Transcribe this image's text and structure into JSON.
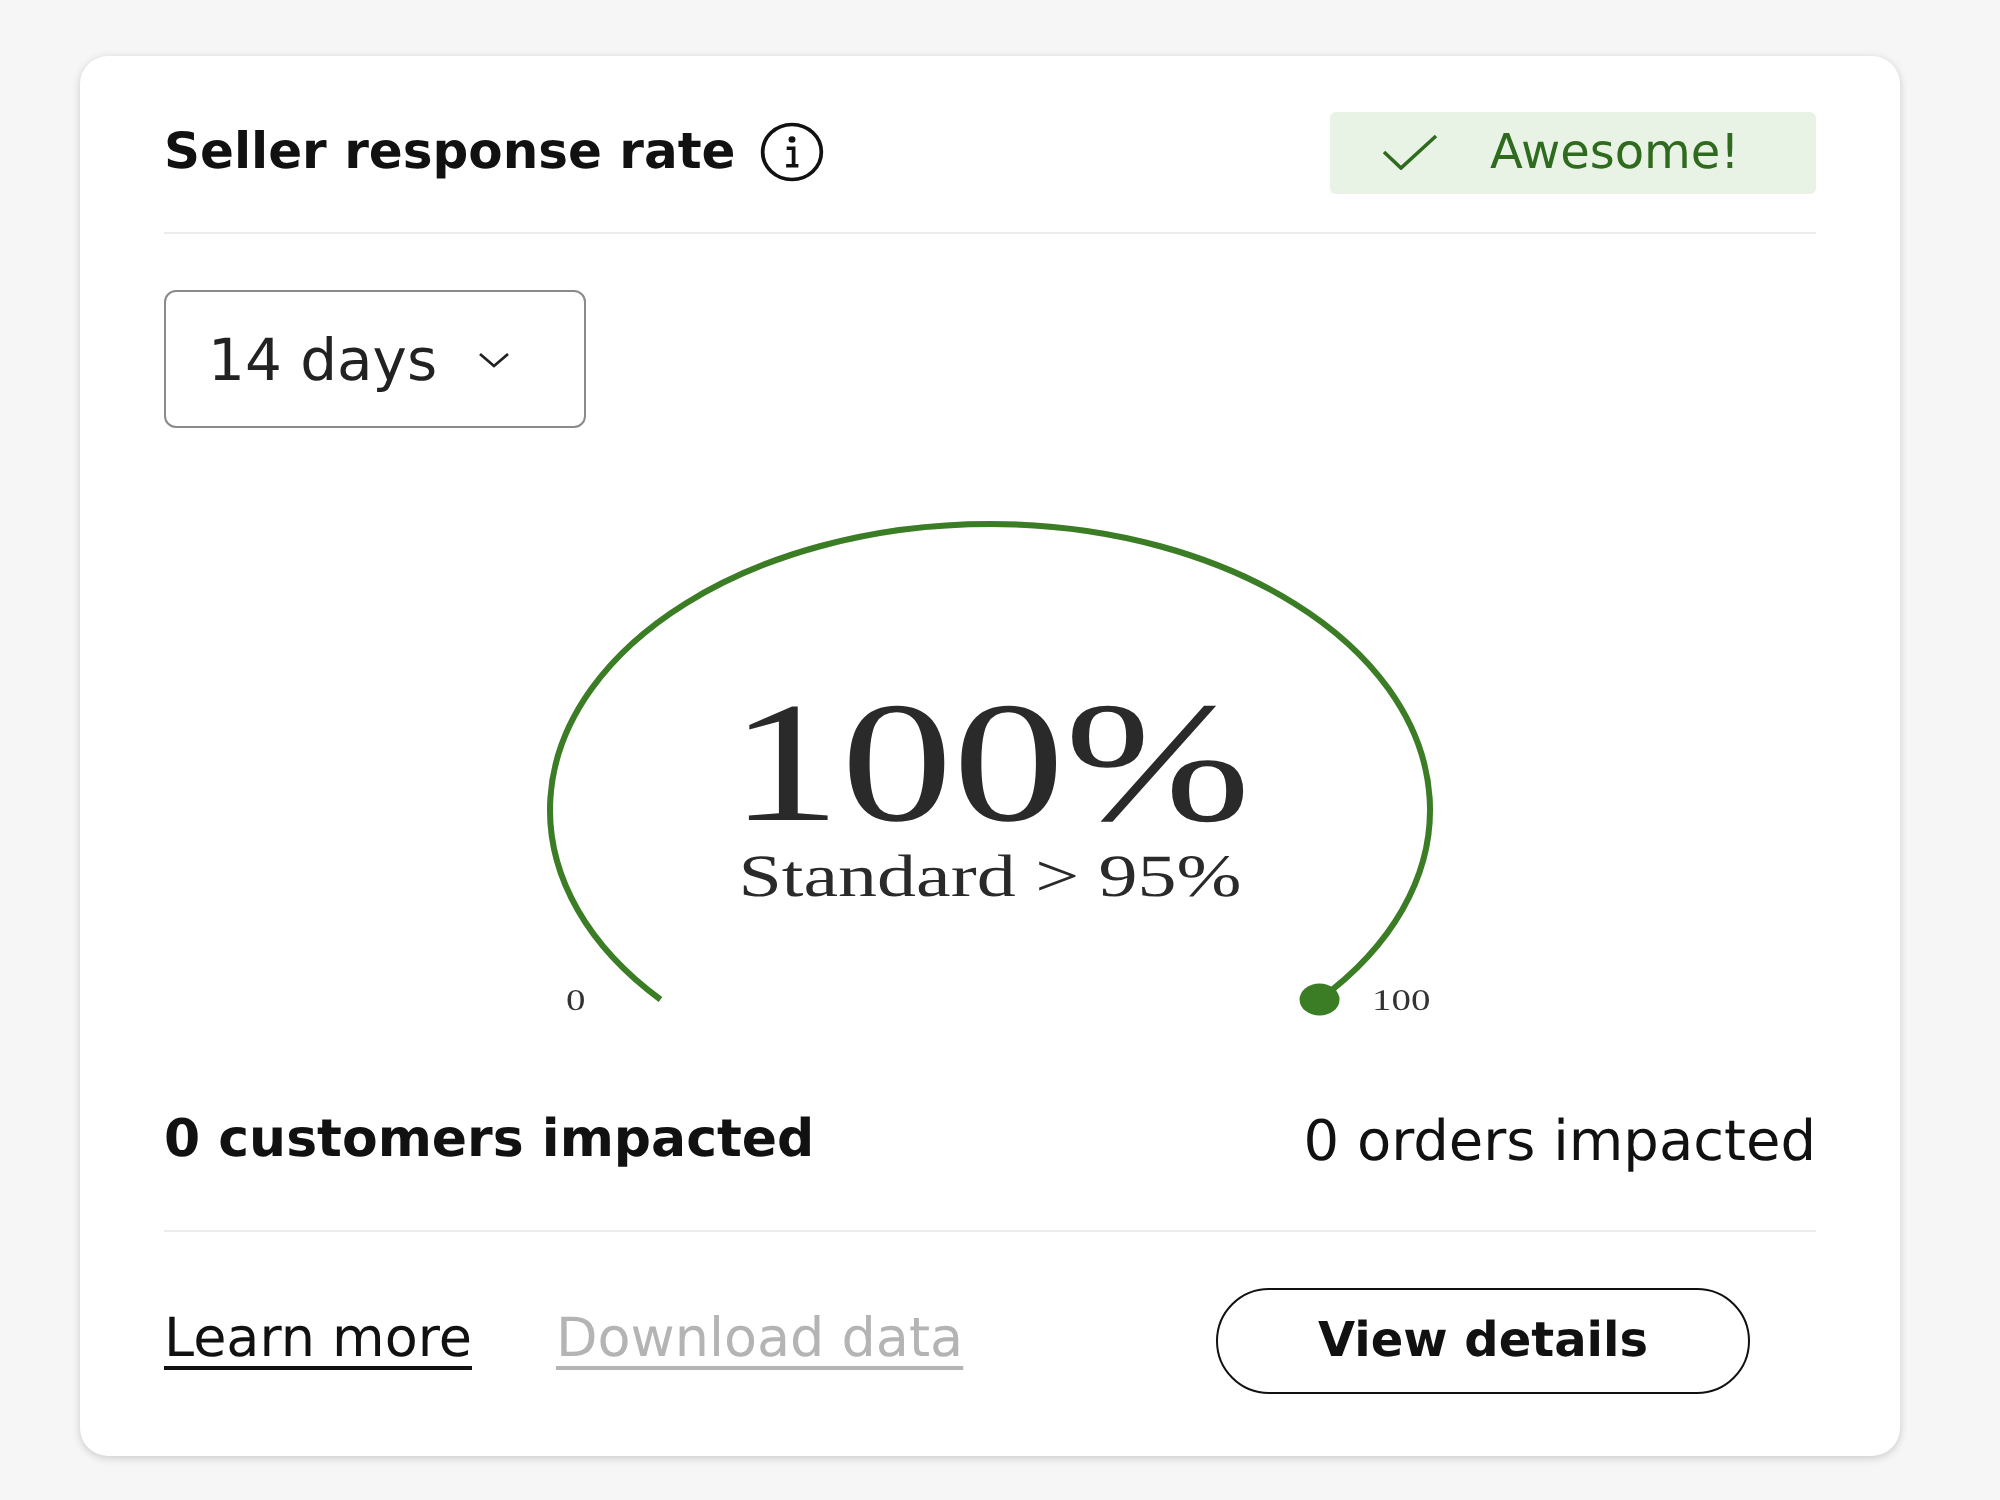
{
  "card": {
    "title": "Seller response rate",
    "status_badge": {
      "label": "Awesome!"
    },
    "period_dropdown": {
      "value": "14 days"
    },
    "gauge": {
      "value": "100%",
      "standard": "Standard > 95%",
      "min_label": "0",
      "max_label": "100",
      "level": 1
    },
    "customers_impacted": "0 customers impacted",
    "orders_impacted": "0 orders impacted",
    "links": [
      {
        "label": "Learn more",
        "disabled": false
      },
      {
        "label": "Download data",
        "disabled": true
      }
    ],
    "view_details_button": "View details"
  }
}
